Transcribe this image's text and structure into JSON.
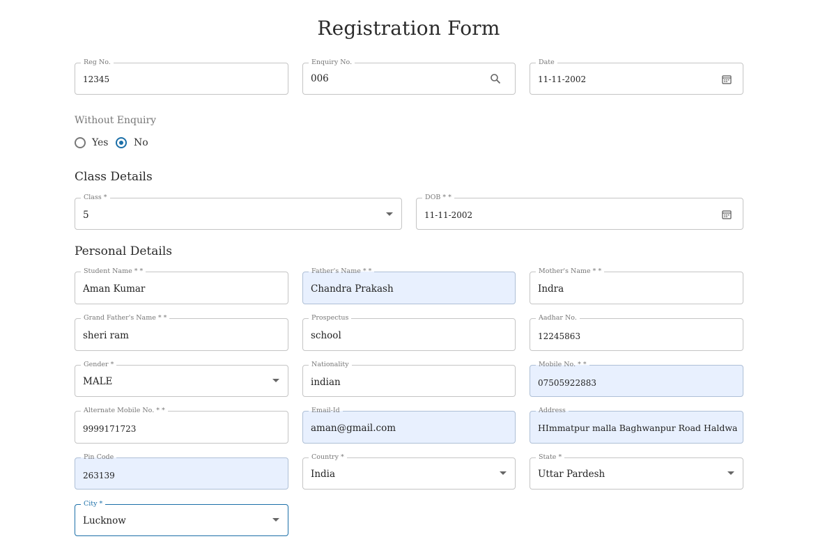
{
  "title": "Registration Form",
  "top_fields": {
    "reg_no": {
      "label": "Reg No.",
      "value": "12345"
    },
    "enquiry_no": {
      "label": "Enquiry No.",
      "value": "006"
    },
    "date": {
      "label": "Date",
      "value": "11-11-2002"
    }
  },
  "without_enquiry": {
    "label": "Without Enquiry",
    "options": [
      "Yes",
      "No"
    ],
    "selected": "No"
  },
  "class_details": {
    "heading": "Class Details",
    "class": {
      "label": "Class *",
      "value": "5"
    },
    "dob": {
      "label": "DOB * *",
      "value": "11-11-2002"
    }
  },
  "personal_details": {
    "heading": "Personal Details",
    "student_name": {
      "label": "Student Name * *",
      "value": "Aman Kumar"
    },
    "father_name": {
      "label": "Father's Name * *",
      "value": "Chandra Prakash"
    },
    "mother_name": {
      "label": "Mother's Name * *",
      "value": "Indra"
    },
    "grand_father_name": {
      "label": "Grand Father's Name * *",
      "value": "sheri ram"
    },
    "prospectus": {
      "label": "Prospectus",
      "value": "school"
    },
    "aadhar_no": {
      "label": "Aadhar No.",
      "value": "12245863"
    },
    "gender": {
      "label": "Gender *",
      "value": "MALE"
    },
    "nationality": {
      "label": "Nationality",
      "value": "indian"
    },
    "mobile_no": {
      "label": "Mobile No. * *",
      "value": "07505922883"
    },
    "alternate_mobile": {
      "label": "Alternate Mobile No. * *",
      "value": "9999171723"
    },
    "email": {
      "label": "Email-Id",
      "value": "aman@gmail.com"
    },
    "address": {
      "label": "Address",
      "value": "HImmatpur malla Baghwanpur Road Haldwani"
    },
    "pin_code": {
      "label": "Pin Code",
      "value": "263139"
    },
    "country": {
      "label": "Country *",
      "value": "India"
    },
    "state": {
      "label": "State *",
      "value": "Uttar Pardesh"
    },
    "city": {
      "label": "City *",
      "value": "Lucknow"
    }
  },
  "colors": {
    "accent": "#1b6fa8",
    "autofill": "#e8f0fe",
    "border": "#c4c4c4"
  },
  "icons": {
    "search": "search-icon",
    "calendar": "calendar-icon",
    "dropdown": "chevron-down-icon"
  }
}
